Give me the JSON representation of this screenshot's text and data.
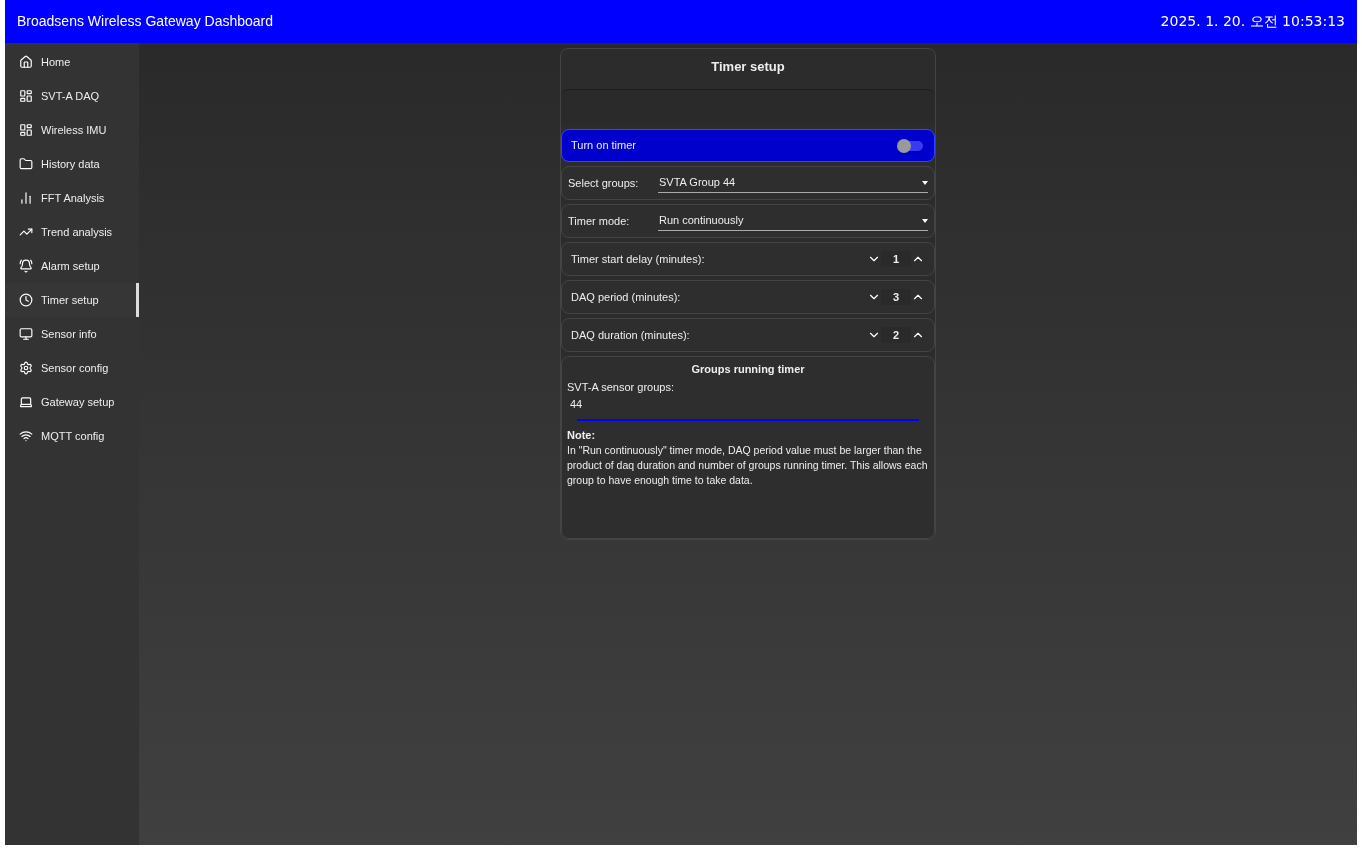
{
  "header": {
    "title": "Broadsens Wireless Gateway Dashboard",
    "datetime": "2025. 1. 20. 오전 10:53:13"
  },
  "sidebar": {
    "items": [
      {
        "label": "Home",
        "selected": false
      },
      {
        "label": "SVT-A DAQ",
        "selected": false
      },
      {
        "label": "Wireless IMU",
        "selected": false
      },
      {
        "label": "History data",
        "selected": false
      },
      {
        "label": "FFT Analysis",
        "selected": false
      },
      {
        "label": "Trend analysis",
        "selected": false
      },
      {
        "label": "Alarm setup",
        "selected": false
      },
      {
        "label": "Timer setup",
        "selected": true
      },
      {
        "label": "Sensor info",
        "selected": false
      },
      {
        "label": "Sensor config",
        "selected": false
      },
      {
        "label": "Gateway setup",
        "selected": false
      },
      {
        "label": "MQTT config",
        "selected": false
      }
    ]
  },
  "panel": {
    "title": "Timer setup",
    "timer_toggle": {
      "label": "Turn on timer",
      "on": false
    },
    "selects": [
      {
        "label": "Select groups:",
        "value": "SVTA Group 44"
      },
      {
        "label": "Timer mode:",
        "value": "Run continuously"
      }
    ],
    "steppers": [
      {
        "label": "Timer start delay (minutes):",
        "value": "1"
      },
      {
        "label": "DAQ period (minutes):",
        "value": "3"
      },
      {
        "label": "DAQ duration (minutes):",
        "value": "2"
      }
    ],
    "groups": {
      "title": "Groups running timer",
      "label": "SVT-A sensor groups:",
      "value": "44",
      "note_title": "Note:",
      "note": "In \"Run continuously\" timer mode, DAQ period value must be larger than the product of daq duration and number of groups running timer. This allows each group to have enough time to take data."
    }
  }
}
